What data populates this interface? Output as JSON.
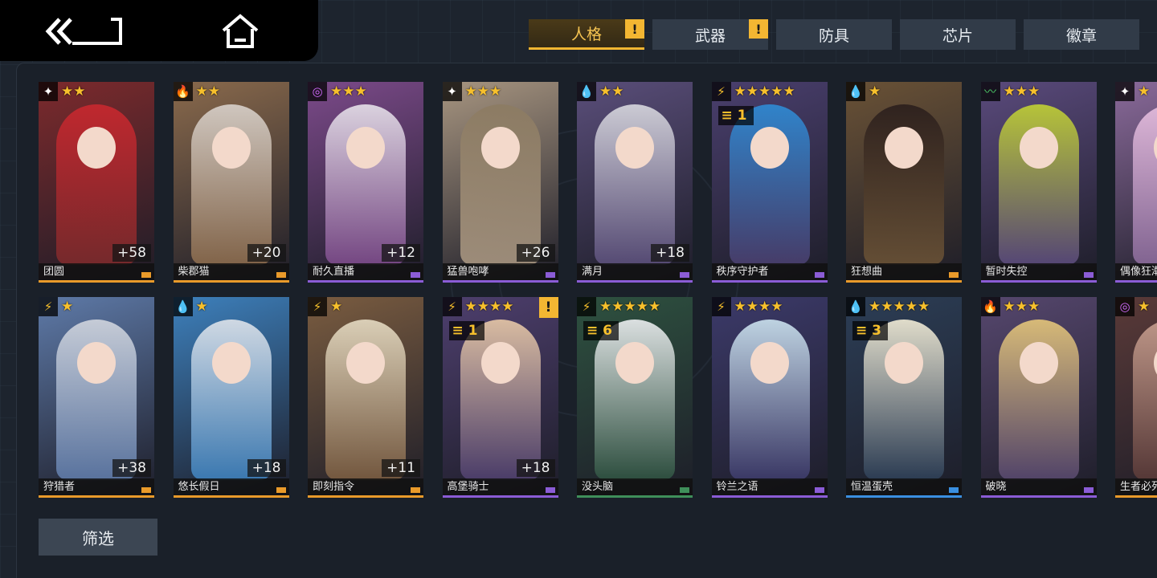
{
  "tabs": [
    {
      "label": "人格",
      "active": true,
      "alert": "!"
    },
    {
      "label": "武器",
      "active": false,
      "alert": "!"
    },
    {
      "label": "防具",
      "active": false,
      "alert": ""
    },
    {
      "label": "芯片",
      "active": false,
      "alert": ""
    },
    {
      "label": "徽章",
      "active": false,
      "alert": ""
    }
  ],
  "filter_label": "筛选",
  "colors": {
    "accent": "#f3b632",
    "purple_rarity": "#8b5cd6",
    "orange_rarity": "#e99a2a",
    "blue_rarity": "#3a8fe0",
    "green_rarity": "#3f8f5a"
  },
  "cards": [
    {
      "name": "团圆",
      "stars": "★★",
      "element": "✦",
      "elem_color": "#ffffff",
      "level": "+58",
      "grade": "",
      "alert": false,
      "bg": "#7d2a2c",
      "fig": "#c9282f",
      "rarity": "#e99a2a"
    },
    {
      "name": "柴郡猫",
      "stars": "★★",
      "element": "🔥",
      "elem_color": "#ff5a2e",
      "level": "+20",
      "grade": "",
      "alert": false,
      "bg": "#8a6a4c",
      "fig": "#d9d2cc",
      "rarity": "#e99a2a"
    },
    {
      "name": "耐久直播",
      "stars": "★★★",
      "element": "◎",
      "elem_color": "#d36cff",
      "level": "+12",
      "grade": "",
      "alert": false,
      "bg": "#7c4a8a",
      "fig": "#e7e2ea",
      "rarity": "#8b5cd6"
    },
    {
      "name": "猛兽咆哮",
      "stars": "★★★",
      "element": "✦",
      "elem_color": "#ffffff",
      "level": "+26",
      "grade": "",
      "alert": false,
      "bg": "#a79580",
      "fig": "#8c7b62",
      "rarity": "#8b5cd6"
    },
    {
      "name": "满月",
      "stars": "★★",
      "element": "💧",
      "elem_color": "#3aaef5",
      "level": "+18",
      "grade": "",
      "alert": false,
      "bg": "#5a4e7a",
      "fig": "#d9d9df",
      "rarity": "#8b5cd6"
    },
    {
      "name": "秩序守护者",
      "stars": "★★★★★",
      "element": "⚡",
      "elem_color": "#f7c02c",
      "level": "",
      "grade": "1",
      "alert": false,
      "bg": "#4a3f6e",
      "fig": "#2e8cd6",
      "rarity": "#8b5cd6"
    },
    {
      "name": "狂想曲",
      "stars": "★",
      "element": "💧",
      "elem_color": "#3aaef5",
      "level": "",
      "grade": "",
      "alert": false,
      "bg": "#6a5236",
      "fig": "#2a1e1c",
      "rarity": "#e99a2a"
    },
    {
      "name": "暂时失控",
      "stars": "★★★",
      "element": "〰",
      "elem_color": "#4fd16a",
      "level": "",
      "grade": "",
      "alert": false,
      "bg": "#5a4a7c",
      "fig": "#c2d233",
      "rarity": "#8b5cd6"
    },
    {
      "name": "偶像狂潮",
      "stars": "★",
      "element": "✦",
      "elem_color": "#ffffff",
      "level": "",
      "grade": "",
      "alert": false,
      "bg": "#8a6a9a",
      "fig": "#e8c0e0",
      "rarity": "#8b5cd6"
    },
    {
      "name": "狩猎者",
      "stars": "★",
      "element": "⚡",
      "elem_color": "#f7c02c",
      "level": "+38",
      "grade": "",
      "alert": false,
      "bg": "#5e7aa8",
      "fig": "#d2d6de",
      "rarity": "#e99a2a"
    },
    {
      "name": "悠长假日",
      "stars": "★",
      "element": "💧",
      "elem_color": "#3aaef5",
      "level": "+18",
      "grade": "",
      "alert": false,
      "bg": "#3d80bc",
      "fig": "#e0e4ea",
      "rarity": "#e99a2a"
    },
    {
      "name": "即刻指令",
      "stars": "★",
      "element": "⚡",
      "elem_color": "#f7c02c",
      "level": "+11",
      "grade": "",
      "alert": false,
      "bg": "#7a5c40",
      "fig": "#e6dcc4",
      "rarity": "#e99a2a"
    },
    {
      "name": "高堡骑士",
      "stars": "★★★★",
      "element": "⚡",
      "elem_color": "#f7c02c",
      "level": "+18",
      "grade": "1",
      "alert": true,
      "bg": "#4e3f6e",
      "fig": "#e9caa8",
      "rarity": "#8b5cd6"
    },
    {
      "name": "没头脑",
      "stars": "★★★★★",
      "element": "⚡",
      "elem_color": "#f7c02c",
      "level": "",
      "grade": "6",
      "alert": false,
      "bg": "#2e5240",
      "fig": "#eef0f2",
      "rarity": "#3f8f5a"
    },
    {
      "name": "铃兰之语",
      "stars": "★★★★",
      "element": "⚡",
      "elem_color": "#f7c02c",
      "level": "",
      "grade": "",
      "alert": false,
      "bg": "#3c3a6a",
      "fig": "#cde4f0",
      "rarity": "#8b5cd6"
    },
    {
      "name": "恒温蛋壳",
      "stars": "★★★★★",
      "element": "💧",
      "elem_color": "#3aaef5",
      "level": "",
      "grade": "3",
      "alert": false,
      "bg": "#2c3e56",
      "fig": "#f4eed8",
      "rarity": "#3a8fe0"
    },
    {
      "name": "破晓",
      "stars": "★★★",
      "element": "🔥",
      "elem_color": "#ff5a2e",
      "level": "",
      "grade": "",
      "alert": false,
      "bg": "#56476e",
      "fig": "#e6c77a",
      "rarity": "#8b5cd6"
    },
    {
      "name": "生者必死",
      "stars": "★",
      "element": "◎",
      "elem_color": "#d36cff",
      "level": "",
      "grade": "",
      "alert": false,
      "bg": "#5a3a38",
      "fig": "#c9a090",
      "rarity": "#e99a2a"
    }
  ]
}
